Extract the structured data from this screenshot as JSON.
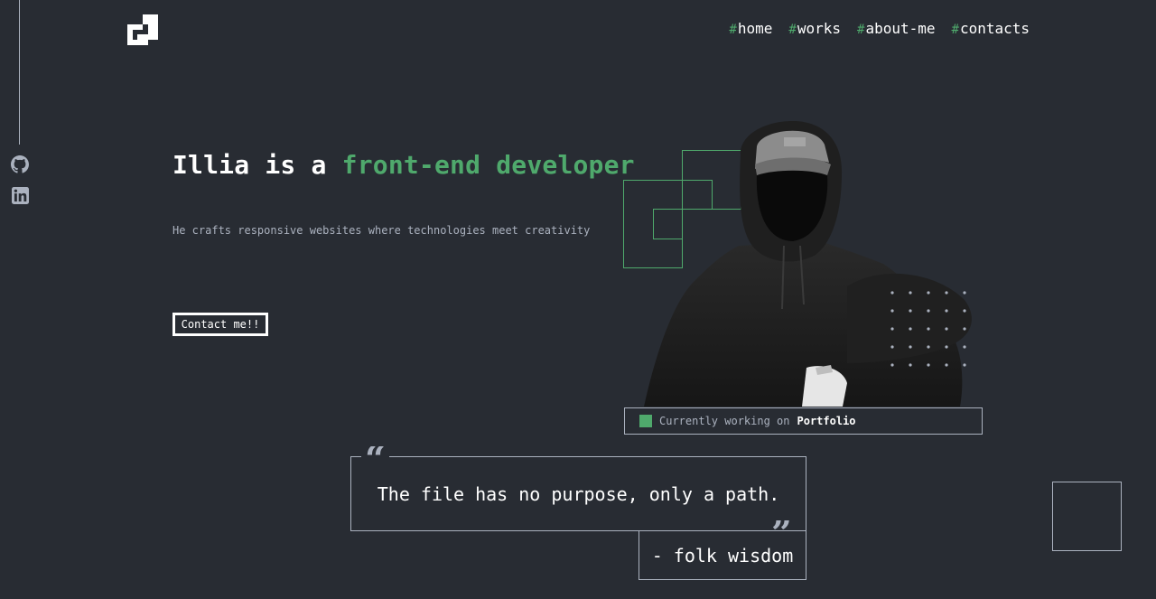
{
  "brand": {
    "logo_icon": "pixel-logo-icon"
  },
  "social": {
    "items": [
      {
        "icon": "github-icon"
      },
      {
        "icon": "linkedin-icon"
      }
    ]
  },
  "nav": {
    "hash": "#",
    "items": [
      {
        "label": "home"
      },
      {
        "label": "works"
      },
      {
        "label": "about-me"
      },
      {
        "label": "contacts"
      }
    ]
  },
  "hero": {
    "title_prefix": "Illia is a ",
    "title_accent": "front-end developer",
    "subtitle": "He crafts responsive websites where technologies meet creativity",
    "cta_label": "Contact me!!"
  },
  "status": {
    "label": "Currently working on",
    "project": "Portfolio"
  },
  "quote": {
    "text": "The file has no purpose, only a path.",
    "author": "- folk wisdom",
    "open_mark": "“",
    "close_mark": "”"
  },
  "colors": {
    "background": "#282c33",
    "accent": "#4fa96c",
    "muted": "#abb2bf",
    "text": "#ffffff"
  }
}
